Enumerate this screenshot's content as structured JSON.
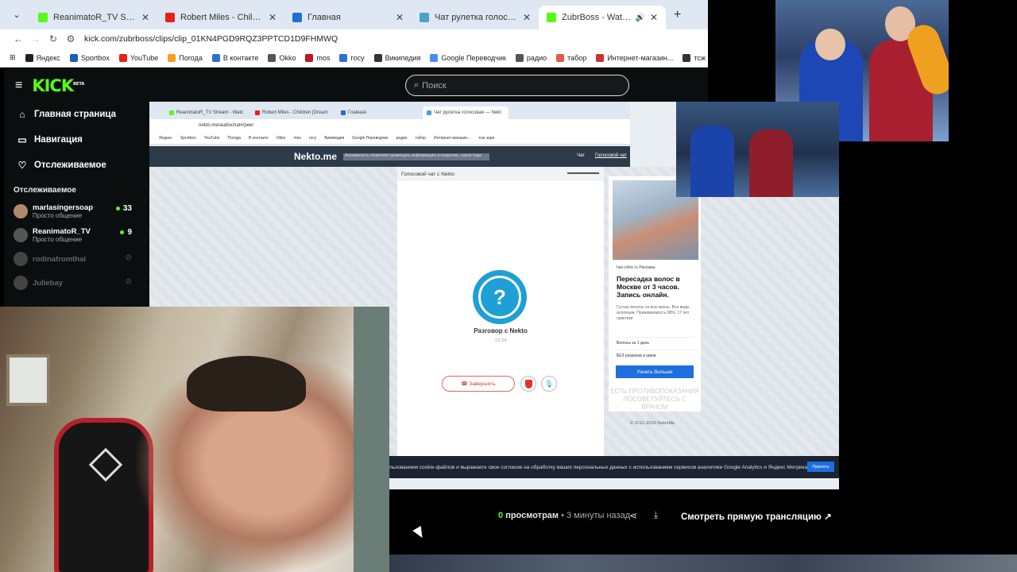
{
  "browser": {
    "tabs": [
      {
        "title": "ReanimatoR_TV Stream - Watch",
        "color": "#53fc18",
        "active": false
      },
      {
        "title": "Robert Miles - Children [Dream",
        "color": "#e62117",
        "active": false
      },
      {
        "title": "Главная",
        "color": "#1f6fd6",
        "active": false
      },
      {
        "title": "Чат рулетка голосовая — Nekt",
        "color": "#4aa3c7",
        "active": false
      },
      {
        "title": "ZubrBoss - Watch clips on K",
        "color": "#53fc18",
        "active": true
      }
    ],
    "url": "kick.com/zubrboss/clips/clip_01KN4PGD9RQZ3PPTCD1D9FHMWQ",
    "bookmarks": [
      {
        "label": "Яндекс",
        "color": "#222"
      },
      {
        "label": "Sportbox",
        "color": "#1560bd"
      },
      {
        "label": "YouTube",
        "color": "#e62117"
      },
      {
        "label": "Погода",
        "color": "#f3a21a"
      },
      {
        "label": "В контакте",
        "color": "#2d6fd4"
      },
      {
        "label": "Okko",
        "color": "#555"
      },
      {
        "label": "mos",
        "color": "#c2131e"
      },
      {
        "label": "госу",
        "color": "#2d6fd4"
      },
      {
        "label": "Википедия",
        "color": "#333"
      },
      {
        "label": "Google Переводчик",
        "color": "#4a8af4"
      },
      {
        "label": "радио",
        "color": "#555"
      },
      {
        "label": "табор",
        "color": "#e05a4a"
      },
      {
        "label": "Интернет-магазин...",
        "color": "#c33"
      },
      {
        "label": "тсж заря",
        "color": "#333"
      }
    ]
  },
  "kick": {
    "logo": "KICK",
    "logo_sup": "BETA",
    "search_placeholder": "Поиск",
    "nav": [
      {
        "label": "Главная страница",
        "icon": "home-icon",
        "glyph": "⌂"
      },
      {
        "label": "Навигация",
        "icon": "compass-icon",
        "glyph": "▭"
      },
      {
        "label": "Отслеживаемое",
        "icon": "heart-icon",
        "glyph": "♡"
      }
    ],
    "following_title": "Отслеживаемое",
    "channels": [
      {
        "name": "marlasingersoap",
        "category": "Просто общение",
        "viewers": "33",
        "live": true
      },
      {
        "name": "ReanimatoR_TV",
        "category": "Просто общение",
        "viewers": "9",
        "live": true
      },
      {
        "name": "rodinafromthai",
        "category": "",
        "viewers": "",
        "live": false
      },
      {
        "name": "Juliebay",
        "category": "",
        "viewers": "",
        "live": false
      }
    ],
    "clip_meta": {
      "views_count": "0",
      "views_label": "просмотрам",
      "time_ago": "• 3 минуты назад",
      "watch_live": "Смотреть прямую трансляцию"
    }
  },
  "inner": {
    "tabs": [
      "ReanimatoR_TV Stream - Watc",
      "Robert Miles - Children [Dream",
      "Главная",
      "Чат рулетка голосовая — Nekt"
    ],
    "url": "nekto.me/audiochat#/peer",
    "bookmarks": [
      "Яндекс",
      "Sportbox",
      "YouTube",
      "Погода",
      "В контакте",
      "Okko",
      "mos",
      "госу",
      "Википедия",
      "Google Переводчик",
      "радио",
      "табор",
      "Интернет-магазин...",
      "тсж заря"
    ],
    "logo": "Nekto.me",
    "banner": "Анонимность позволяет размещать информацию в открытом, сырое ооде",
    "nav_chat": "Чат",
    "nav_voice": "Голосовой чат",
    "panel_title": "Голосовой чат с Nekto",
    "question_mark": "?",
    "talking_with": "Разговор с Nekto",
    "timer": "13:24",
    "end_button": "Завершить",
    "ad": {
      "site": "hair-clinic.ru  Реклама",
      "title": "Пересадка волос в Москве от 3 часов. Запись онлайн.",
      "text": "Густые волосы на всю жизнь. Все виды алопеции. Приживаемость 98%, 17 лет практики",
      "link1": "Волосы за 1 день",
      "link2": "БЕЗ разрезов и швов",
      "button": "Узнать больше",
      "warning": "ЕСТЬ ПРОТИВОПОКАЗАНИЯ ПОСОВЕТУЙТЕСЬ С ВРАЧОМ"
    },
    "copyright": "© 2011–2026 NektoMe",
    "cookie_text": "льзованием cookie-файлов и выражаете свое согласие на обработку ваших персональных данных с использованием сервисов аналитики Google Analytics и Яндекс Метрика.",
    "accept": "Принять"
  }
}
